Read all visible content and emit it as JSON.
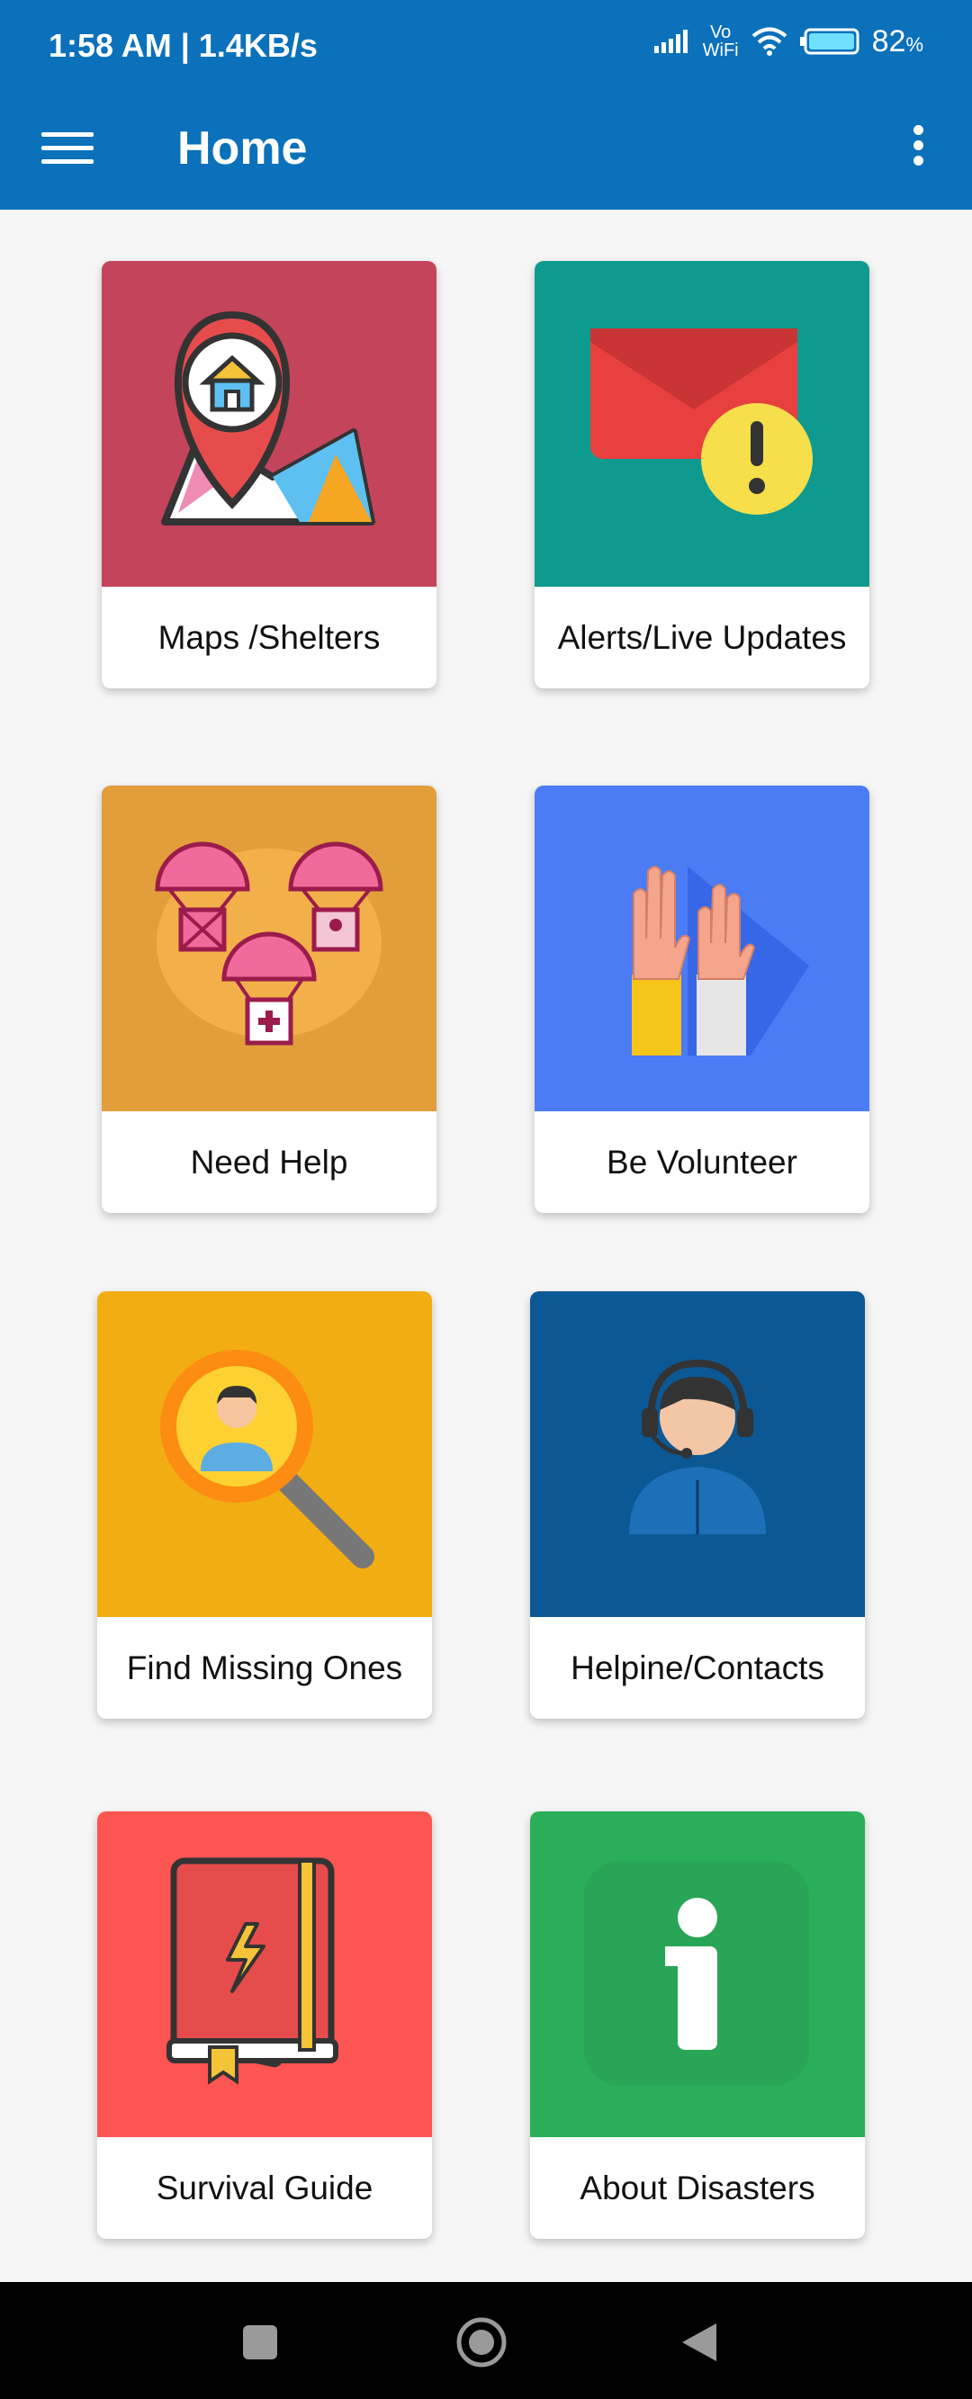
{
  "status": {
    "time_speed": "1:58 AM | 1.4KB/s",
    "vowifi": "Vo\nWiFi",
    "battery": "82",
    "battery_unit": "%"
  },
  "appbar": {
    "title": "Home"
  },
  "tiles": [
    {
      "label": "Maps /Shelters",
      "color": "#c4445b",
      "icon": "map-pin-house-icon"
    },
    {
      "label": "Alerts/Live Updates",
      "color": "#0f9a8f",
      "icon": "envelope-alert-icon"
    },
    {
      "label": "Need Help",
      "color": "#e29e3a",
      "icon": "parachute-supplies-icon"
    },
    {
      "label": "Be Volunteer",
      "color": "#4b7bf5",
      "icon": "raised-hands-icon"
    },
    {
      "label": "Find Missing Ones",
      "color": "#f2ad12",
      "icon": "magnifier-person-icon"
    },
    {
      "label": "Helpine/Contacts",
      "color": "#0b5894",
      "icon": "headset-agent-icon"
    },
    {
      "label": "Survival Guide",
      "color": "#fd5552",
      "icon": "book-lightning-icon"
    },
    {
      "label": "About Disasters",
      "color": "#2aae5a",
      "icon": "info-icon"
    }
  ],
  "navbar": {
    "buttons": [
      "recent-apps-icon",
      "home-icon",
      "back-icon"
    ]
  }
}
